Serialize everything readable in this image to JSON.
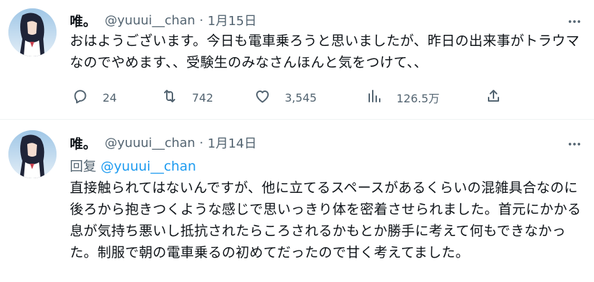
{
  "tweets": [
    {
      "name": "唯。",
      "handle": "@yuuui__chan",
      "separator": "·",
      "date": "1月15日",
      "text": "おはようございます。今日も電車乗ろうと思いましたが、昨日の出来事がトラウマなのでやめます、、受験生のみなさんほんと気をつけて、、",
      "actions": {
        "replies": "24",
        "retweets": "742",
        "likes": "3,545",
        "views": "126.5万"
      }
    },
    {
      "name": "唯。",
      "handle": "@yuuui__chan",
      "separator": "·",
      "date": "1月14日",
      "reply_prefix": "回复",
      "reply_to": "@yuuui__chan",
      "text": "直接触られてはないんですが、他に立てるスペースがあるくらいの混雑具合なのに後ろから抱きつくような感じで思いっきり体を密着させられました。首元にかかる息が気持ち悪いし抵抗されたらころされるかもとか勝手に考えて何もできなかった。制服で朝の電車乗るの初めてだったので甘く考えてました。"
    }
  ],
  "icons": {
    "more": "more-icon",
    "reply": "reply-icon",
    "retweet": "retweet-icon",
    "like": "heart-icon",
    "views": "views-icon",
    "share": "share-icon"
  },
  "colors": {
    "text": "#0f1419",
    "secondary": "#536471",
    "link": "#1d9bf0",
    "divider": "#eff3f4"
  }
}
